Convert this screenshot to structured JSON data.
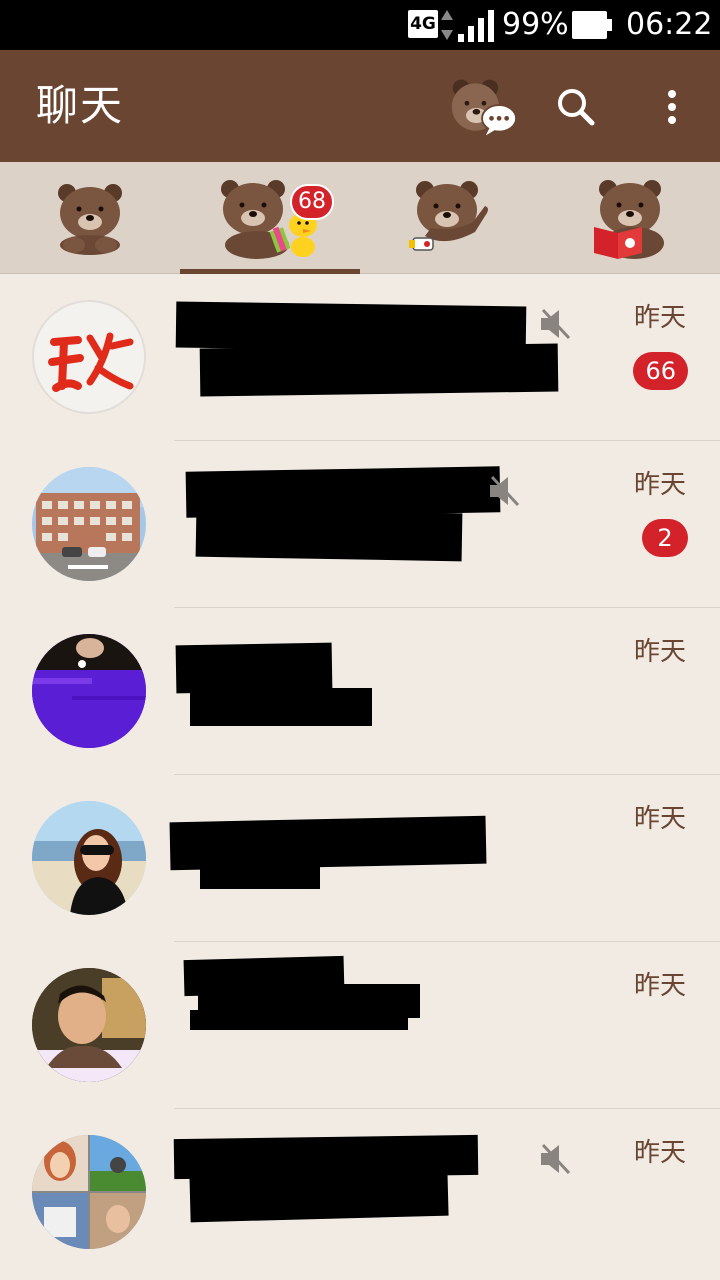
{
  "status_bar": {
    "network": "4G",
    "battery_percent": "99%",
    "time": "06:22"
  },
  "header": {
    "title": "聊天"
  },
  "tabs": [
    {
      "name": "friends",
      "badge": ""
    },
    {
      "name": "chats",
      "badge": "68",
      "active": true
    },
    {
      "name": "timeline",
      "badge": ""
    },
    {
      "name": "more",
      "badge": ""
    }
  ],
  "chats": [
    {
      "time": "昨天",
      "unread": "66",
      "muted": true
    },
    {
      "time": "昨天",
      "unread": "2",
      "muted": true
    },
    {
      "time": "昨天",
      "unread": "",
      "muted": false
    },
    {
      "time": "昨天",
      "unread": "",
      "muted": false
    },
    {
      "time": "昨天",
      "unread": "",
      "muted": false
    },
    {
      "time": "昨天",
      "unread": "",
      "muted": true
    }
  ],
  "colors": {
    "brand": "#6a4632",
    "tab_bg": "#ddd2c8",
    "list_bg": "#f1ebe4",
    "badge": "#d4222a"
  }
}
